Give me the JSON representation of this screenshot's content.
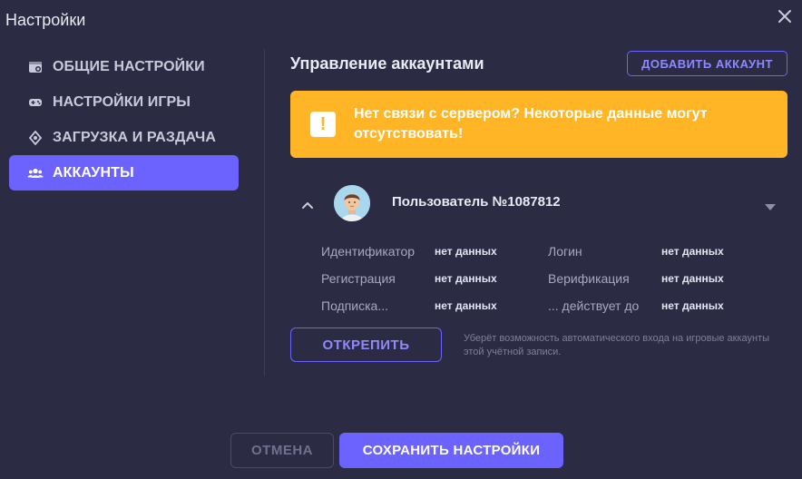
{
  "window": {
    "title": "Настройки"
  },
  "sidebar": {
    "items": [
      {
        "label": "ОБЩИЕ НАСТРОЙКИ",
        "icon": "settings-window-icon",
        "active": false
      },
      {
        "label": "НАСТРОЙКИ ИГРЫ",
        "icon": "gamepad-icon",
        "active": false
      },
      {
        "label": "ЗАГРУЗКА И РАЗДАЧА",
        "icon": "torrent-icon",
        "active": false
      },
      {
        "label": "АККАУНТЫ",
        "icon": "users-icon",
        "active": true
      }
    ]
  },
  "main": {
    "title": "Управление аккаунтами",
    "add_button": "ДОБАВИТЬ АККАУНТ",
    "warning": "Нет связи с сервером? Некоторые данные могут отсутствовать!",
    "account": {
      "username": "Пользователь №1087812",
      "fields": [
        {
          "label": "Идентификатор",
          "value": "нет данных",
          "label2": "Логин",
          "value2": "нет данных"
        },
        {
          "label": "Регистрация",
          "value": "нет данных",
          "label2": "Верификация",
          "value2": "нет данных"
        },
        {
          "label": "Подписка...",
          "value": "нет данных",
          "label2": "... действует до",
          "value2": "нет данных"
        }
      ],
      "unpin_button": "ОТКРЕПИТЬ",
      "unpin_hint": "Уберёт возможность автоматического входа на игровые аккаунты этой учётной записи."
    }
  },
  "footer": {
    "cancel": "ОТМЕНА",
    "save": "СОХРАНИТЬ НАСТРОЙКИ"
  },
  "colors": {
    "background": "#2b2c43",
    "accent": "#6c63ff",
    "warning": "#ffb526"
  }
}
